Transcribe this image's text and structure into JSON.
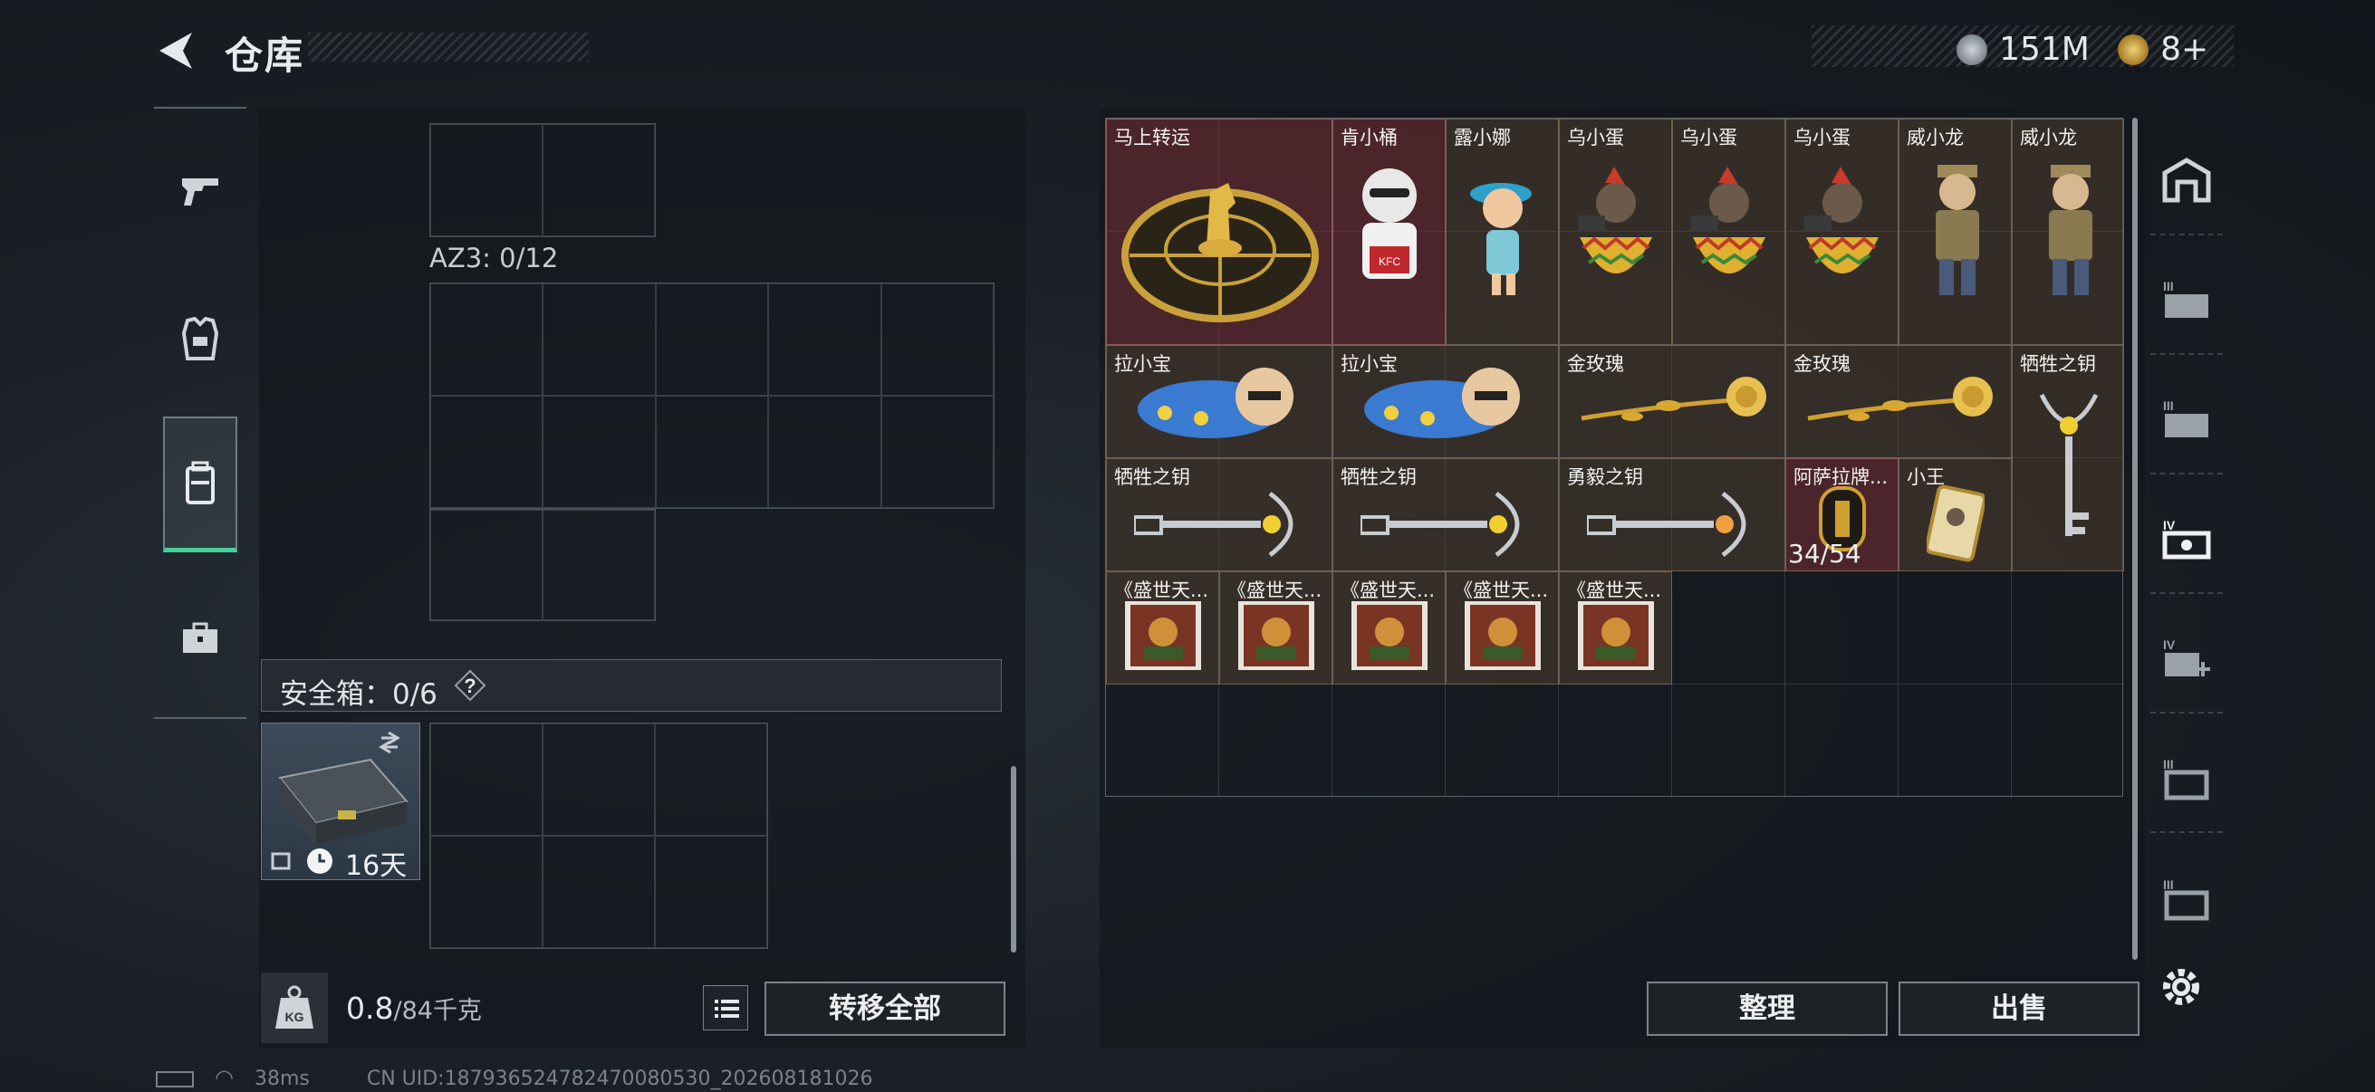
{
  "header": {
    "title": "仓库",
    "currency_silver": "151M",
    "currency_gold": "8+"
  },
  "left": {
    "az3_label": "AZ3: 0/12",
    "safe_label": "安全箱：0/6",
    "safe_help": "?",
    "safe_days": "16天",
    "weight_value": "0.8",
    "weight_capacity": "/84千克",
    "transfer_all": "转移全部"
  },
  "warehouse": {
    "items": [
      {
        "label": "马上转运",
        "icon": "golden-horse-dial-icon"
      },
      {
        "label": "肯小桶",
        "icon": "kfc-figure-icon"
      },
      {
        "label": "露小娜",
        "icon": "girl-figure-icon"
      },
      {
        "label": "乌小蛋",
        "icon": "egg-soldier-icon"
      },
      {
        "label": "乌小蛋",
        "icon": "egg-soldier-icon"
      },
      {
        "label": "乌小蛋",
        "icon": "egg-soldier-icon"
      },
      {
        "label": "威小龙",
        "icon": "soldier-figure-icon"
      },
      {
        "label": "威小龙",
        "icon": "soldier-figure-icon"
      },
      {
        "label": "拉小宝",
        "icon": "lying-figure-icon"
      },
      {
        "label": "拉小宝",
        "icon": "lying-figure-icon"
      },
      {
        "label": "金玫瑰",
        "icon": "gold-rose-icon"
      },
      {
        "label": "金玫瑰",
        "icon": "gold-rose-icon"
      },
      {
        "label": "牺牲之钥",
        "icon": "key-icon"
      },
      {
        "label": "牺牲之钥",
        "icon": "key-icon"
      },
      {
        "label": "牺牲之钥",
        "icon": "key-icon"
      },
      {
        "label": "勇毅之钥",
        "icon": "key-icon"
      },
      {
        "label": "阿萨拉牌...",
        "icon": "card-icon",
        "count": "34/54"
      },
      {
        "label": "小王",
        "icon": "card-icon"
      },
      {
        "label": "《盛世天...",
        "icon": "book-icon"
      },
      {
        "label": "《盛世天...",
        "icon": "book-icon"
      },
      {
        "label": "《盛世天...",
        "icon": "book-icon"
      },
      {
        "label": "《盛世天...",
        "icon": "book-icon"
      },
      {
        "label": "《盛世天...",
        "icon": "book-icon"
      }
    ],
    "sort_label": "整理",
    "sell_label": "出售"
  },
  "status_bar": {
    "latency": "38ms",
    "uid": "CN UID:187936524782470080530_202608181026"
  },
  "colors": {
    "accent_green": "#43d29a",
    "item_red": "#783034",
    "item_brown": "#5c4834"
  }
}
